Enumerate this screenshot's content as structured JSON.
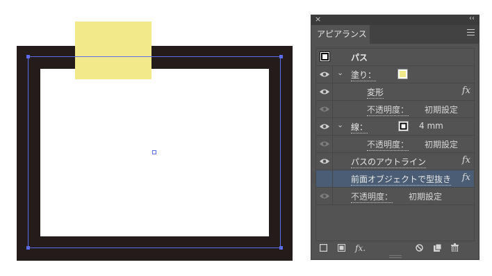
{
  "panel": {
    "close": "×",
    "collapse": "‹‹",
    "tab": "アピアランス",
    "header": "パス",
    "rows": [
      {
        "label": "塗り：",
        "value": ""
      },
      {
        "label": "変形",
        "value": ""
      },
      {
        "label": "不透明度：",
        "value": "初期設定"
      },
      {
        "label": "線：",
        "value": "4 mm"
      },
      {
        "label": "不透明度：",
        "value": "初期設定"
      },
      {
        "label": "パスのアウトライン",
        "value": ""
      },
      {
        "label": "前面オブジェクトで型抜き",
        "value": ""
      },
      {
        "label": "不透明度：",
        "value": "初期設定"
      }
    ],
    "fx": "fx",
    "fx_bottom": "fx."
  },
  "colors": {
    "fill_swatch": "#f2ea8a",
    "artwork_stroke": "#231c1a",
    "selection": "#5b6cf0",
    "panel_bg": "#535353",
    "row_selected": "#4b5d75"
  }
}
